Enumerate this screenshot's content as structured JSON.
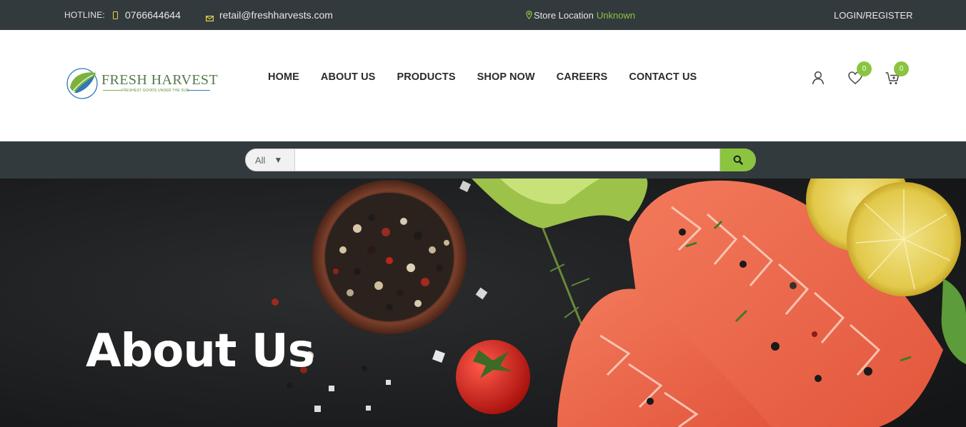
{
  "topbar": {
    "hotline_label": "HOTLINE:",
    "phone": "0766644644",
    "email": "retail@freshharvests.com",
    "store_label": "Store Location",
    "store_value": "Unknown",
    "login": "LOGIN/REGISTER"
  },
  "brand": {
    "name": "FRESH HARVEST",
    "tagline": "FRESHEST GOODS UNDER THE SUN"
  },
  "nav": {
    "items": [
      "HOME",
      "ABOUT US",
      "PRODUCTS",
      "SHOP NOW",
      "CAREERS",
      "CONTACT US"
    ]
  },
  "header_icons": {
    "account_icon": "user-icon",
    "wishlist_icon": "heart-icon",
    "wishlist_count": "0",
    "cart_icon": "cart-icon",
    "cart_count": "0"
  },
  "search": {
    "category_selected": "All",
    "placeholder": "",
    "button_icon": "search-icon"
  },
  "hero": {
    "title": "About Us"
  },
  "colors": {
    "accent_green": "#8bc43f",
    "dark_bar": "#323a3e",
    "brand_green": "#557a4c"
  }
}
